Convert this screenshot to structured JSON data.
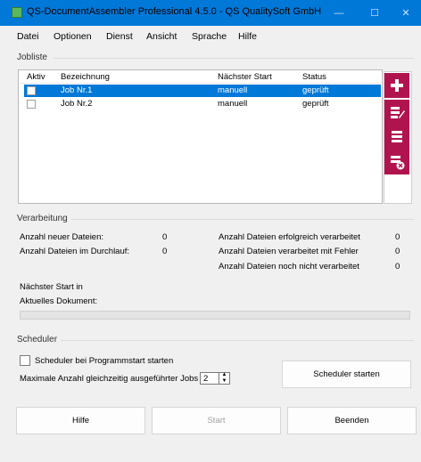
{
  "window": {
    "title": "QS-DocumentAssembler Professional 4.5.0 - QS QualitySoft GmbH",
    "minimize_glyph": "—",
    "maximize_glyph": "☐",
    "close_glyph": "✕"
  },
  "menu": [
    "Datei",
    "Optionen",
    "Dienst",
    "Ansicht",
    "Sprache",
    "Hilfe"
  ],
  "jobliste": {
    "label": "Jobliste",
    "columns": [
      "Aktiv",
      "Bezeichnung",
      "Nächster Start",
      "Status"
    ],
    "rows": [
      {
        "name": "Job Nr.1",
        "next_start": "manuell",
        "status": "geprüft",
        "selected": true
      },
      {
        "name": "Job Nr.2",
        "next_start": "manuell",
        "status": "geprüft",
        "selected": false
      }
    ]
  },
  "verarbeitung": {
    "label": "Verarbeitung",
    "left": [
      {
        "label": "Anzahl neuer Dateien:",
        "value": "0"
      },
      {
        "label": "Anzahl Dateien im Durchlauf:",
        "value": "0"
      }
    ],
    "right": [
      {
        "label": "Anzahl Dateien erfolgreich verarbeitet",
        "value": "0"
      },
      {
        "label": "Anzahl Dateien verarbeitet mit Fehler",
        "value": "0"
      },
      {
        "label": "Anzahl Dateien noch nicht verarbeitet",
        "value": "0"
      }
    ],
    "next_start_label": "Nächster Start in",
    "current_doc_label": "Aktuelles Dokument:"
  },
  "scheduler": {
    "label": "Scheduler",
    "autostart_label": "Scheduler bei Programmstart starten",
    "max_jobs_label": "Maximale Anzahl gleichzeitig ausgeführter Jobs",
    "max_jobs_value": "2",
    "start_button": "Scheduler starten"
  },
  "footer": {
    "help": "Hilfe",
    "start": "Start",
    "exit": "Beenden"
  },
  "colors": {
    "accent": "#0078d7",
    "side_buttons": "#b0144f"
  }
}
